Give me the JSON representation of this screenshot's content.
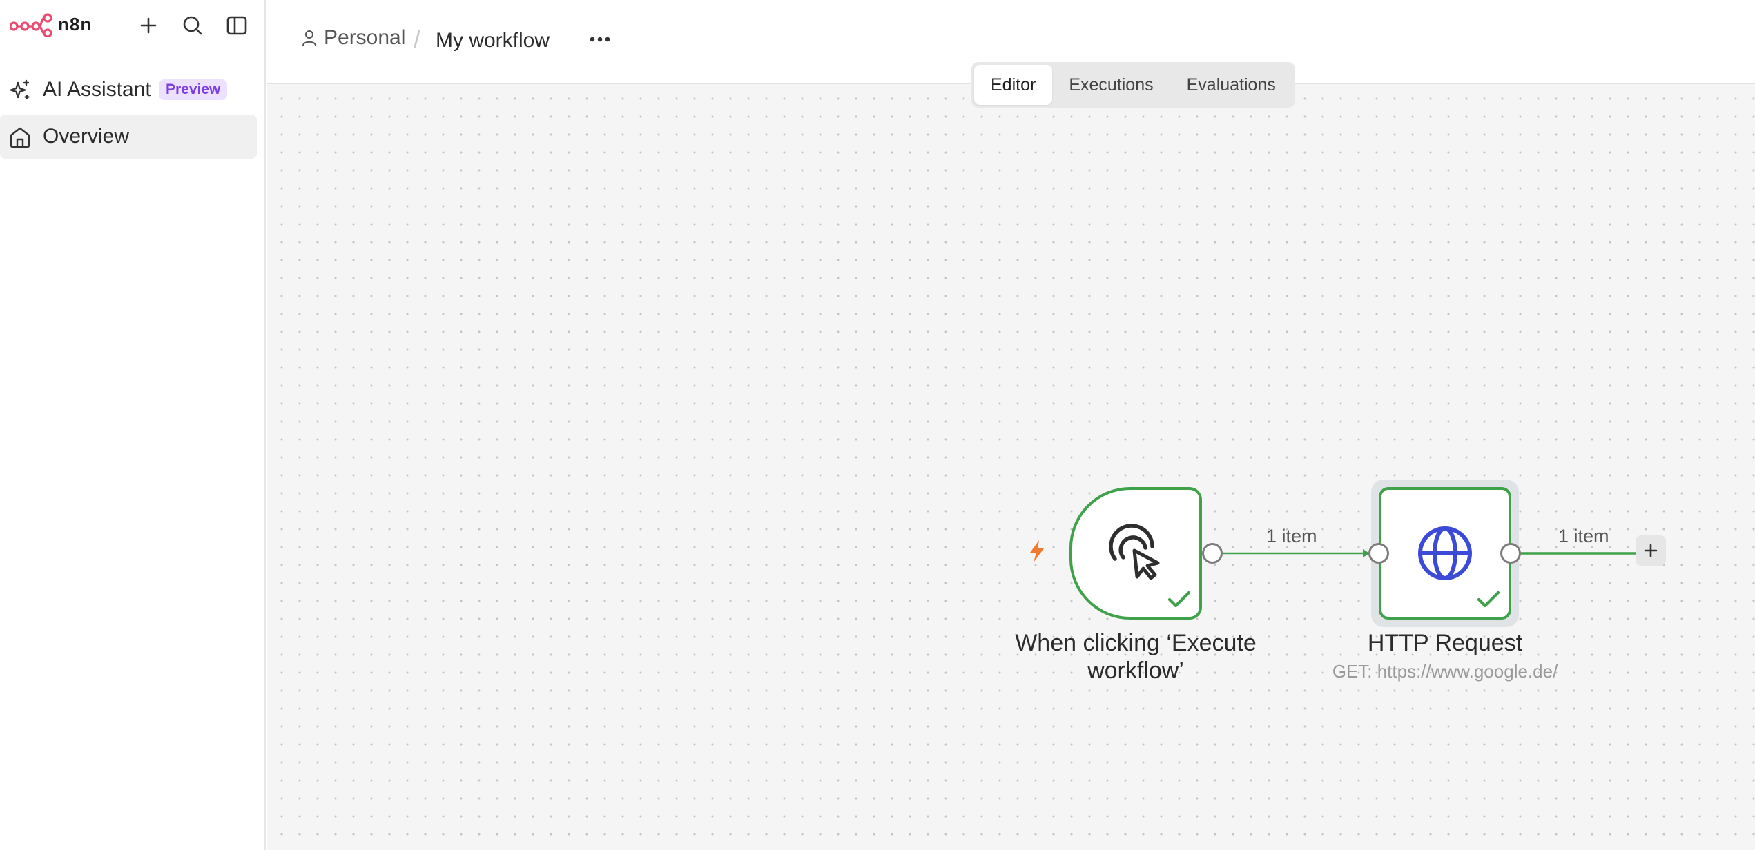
{
  "app": {
    "brand": "n8n",
    "accent_color": "#ea4b71"
  },
  "sidebar": {
    "top_icons": [
      "plus-icon",
      "search-icon",
      "panel-toggle-icon"
    ],
    "items": [
      {
        "label": "AI Assistant",
        "icon": "sparkles-icon",
        "badge": "Preview",
        "active": false
      },
      {
        "label": "Overview",
        "icon": "home-icon",
        "active": true
      }
    ]
  },
  "header": {
    "breadcrumb": {
      "project": "Personal",
      "separator": "/",
      "workflow_name": "My workflow"
    },
    "tabs": [
      {
        "label": "Editor",
        "active": true
      },
      {
        "label": "Executions",
        "active": false
      },
      {
        "label": "Evaluations",
        "active": false
      }
    ]
  },
  "canvas": {
    "nodes": [
      {
        "name": "When clicking ‘Execute workflow’",
        "label_line1": "When clicking ‘Execute",
        "label_line2": "workflow’",
        "type": "trigger",
        "icon": "cursor-click-icon",
        "status": "success"
      },
      {
        "name": "HTTP Request",
        "subtitle": "GET: https://www.google.de/",
        "type": "action",
        "icon": "globe-icon",
        "status": "success"
      }
    ],
    "edges": [
      {
        "label": "1 item"
      },
      {
        "label": "1 item"
      }
    ],
    "colors": {
      "success": "#3fa14a",
      "trigger_bolt": "#f07b2f",
      "http_icon": "#3b4bd8"
    }
  }
}
